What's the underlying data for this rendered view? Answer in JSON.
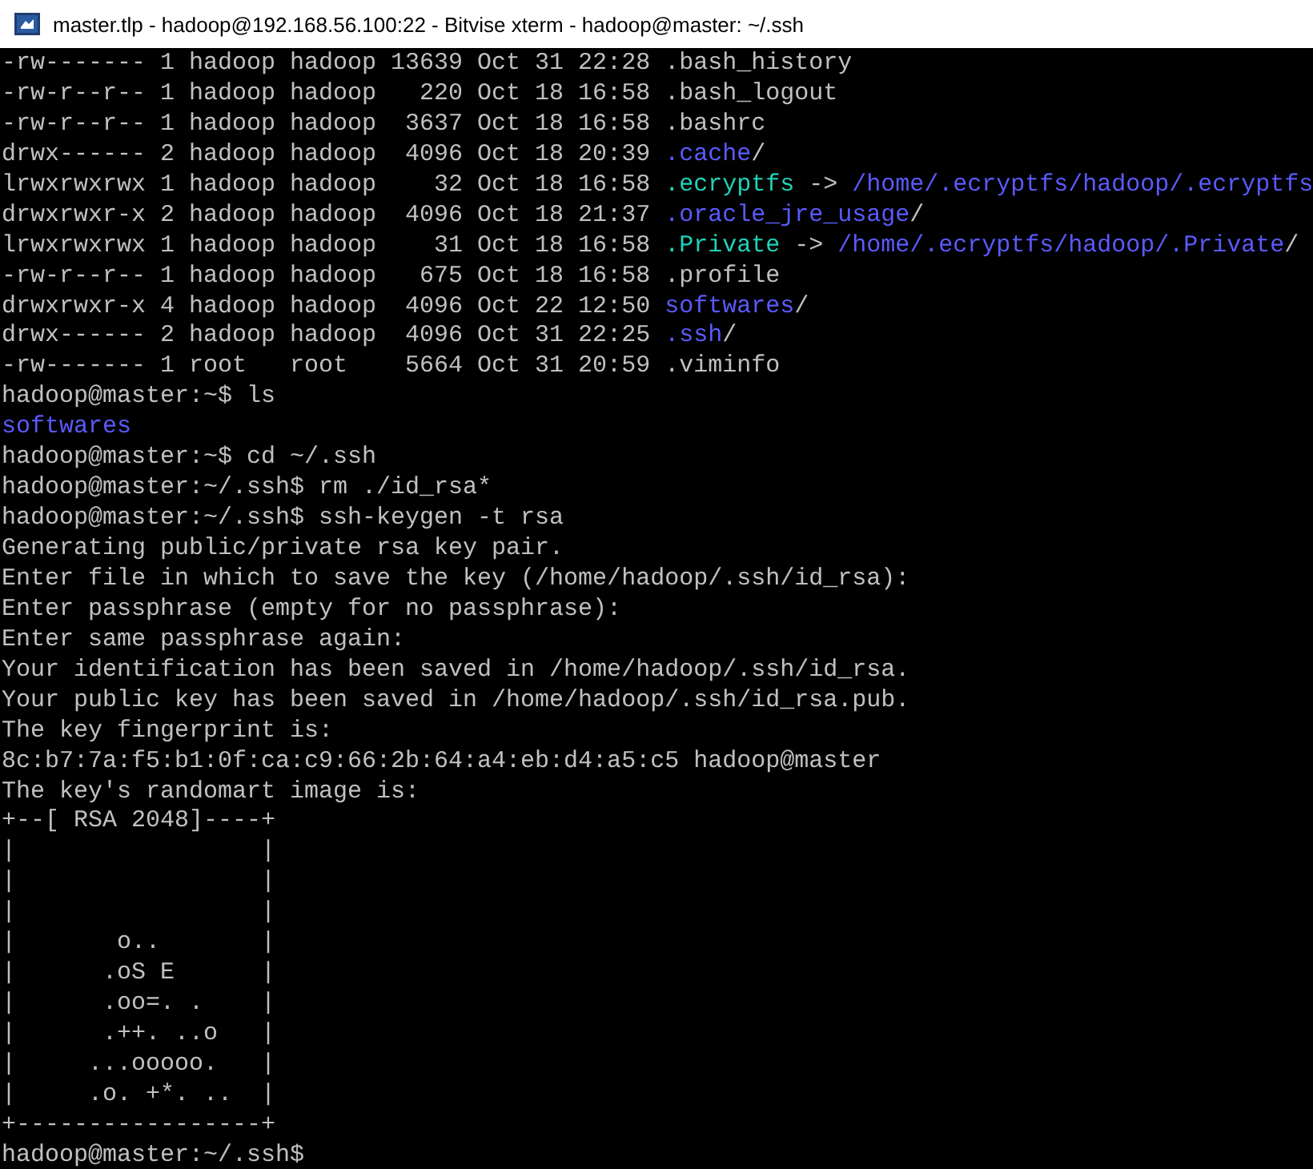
{
  "window": {
    "title": "master.tlp - hadoop@192.168.56.100:22 - Bitvise xterm - hadoop@master: ~/.ssh"
  },
  "terminal": {
    "lines": [
      {
        "segments": [
          {
            "kind": "plain",
            "text": "-rw------- 1 hadoop hadoop 13639 Oct 31 22:28 .bash_history"
          }
        ]
      },
      {
        "segments": [
          {
            "kind": "plain",
            "text": "-rw-r--r-- 1 hadoop hadoop   220 Oct 18 16:58 .bash_logout"
          }
        ]
      },
      {
        "segments": [
          {
            "kind": "plain",
            "text": "-rw-r--r-- 1 hadoop hadoop  3637 Oct 18 16:58 .bashrc"
          }
        ]
      },
      {
        "segments": [
          {
            "kind": "plain",
            "text": "drwx------ 2 hadoop hadoop  4096 Oct 18 20:39 "
          },
          {
            "kind": "dir",
            "text": ".cache"
          },
          {
            "kind": "plain",
            "text": "/"
          }
        ]
      },
      {
        "segments": [
          {
            "kind": "plain",
            "text": "lrwxrwxrwx 1 hadoop hadoop    32 Oct 18 16:58 "
          },
          {
            "kind": "link",
            "text": ".ecryptfs"
          },
          {
            "kind": "plain",
            "text": " -> "
          },
          {
            "kind": "dir",
            "text": "/home/.ecryptfs/hadoop/.ecryptfs"
          }
        ]
      },
      {
        "segments": [
          {
            "kind": "plain",
            "text": "drwxrwxr-x 2 hadoop hadoop  4096 Oct 18 21:37 "
          },
          {
            "kind": "dir",
            "text": ".oracle_jre_usage"
          },
          {
            "kind": "plain",
            "text": "/"
          }
        ]
      },
      {
        "segments": [
          {
            "kind": "plain",
            "text": "lrwxrwxrwx 1 hadoop hadoop    31 Oct 18 16:58 "
          },
          {
            "kind": "link",
            "text": ".Private"
          },
          {
            "kind": "plain",
            "text": " -> "
          },
          {
            "kind": "dir",
            "text": "/home/.ecryptfs/hadoop/.Private"
          },
          {
            "kind": "plain",
            "text": "/"
          }
        ]
      },
      {
        "segments": [
          {
            "kind": "plain",
            "text": "-rw-r--r-- 1 hadoop hadoop   675 Oct 18 16:58 .profile"
          }
        ]
      },
      {
        "segments": [
          {
            "kind": "plain",
            "text": "drwxrwxr-x 4 hadoop hadoop  4096 Oct 22 12:50 "
          },
          {
            "kind": "dir",
            "text": "softwares"
          },
          {
            "kind": "plain",
            "text": "/"
          }
        ]
      },
      {
        "segments": [
          {
            "kind": "plain",
            "text": "drwx------ 2 hadoop hadoop  4096 Oct 31 22:25 "
          },
          {
            "kind": "dir",
            "text": ".ssh"
          },
          {
            "kind": "plain",
            "text": "/"
          }
        ]
      },
      {
        "segments": [
          {
            "kind": "plain",
            "text": "-rw------- 1 root   root    5664 Oct 31 20:59 .viminfo"
          }
        ]
      },
      {
        "segments": [
          {
            "kind": "plain",
            "text": "hadoop@master:~$ ls"
          }
        ]
      },
      {
        "segments": [
          {
            "kind": "dir",
            "text": "softwares"
          }
        ]
      },
      {
        "segments": [
          {
            "kind": "plain",
            "text": "hadoop@master:~$ cd ~/.ssh"
          }
        ]
      },
      {
        "segments": [
          {
            "kind": "plain",
            "text": "hadoop@master:~/.ssh$ rm ./id_rsa*"
          }
        ]
      },
      {
        "segments": [
          {
            "kind": "plain",
            "text": "hadoop@master:~/.ssh$ ssh-keygen -t rsa"
          }
        ]
      },
      {
        "segments": [
          {
            "kind": "plain",
            "text": "Generating public/private rsa key pair."
          }
        ]
      },
      {
        "segments": [
          {
            "kind": "plain",
            "text": "Enter file in which to save the key (/home/hadoop/.ssh/id_rsa):"
          }
        ]
      },
      {
        "segments": [
          {
            "kind": "plain",
            "text": "Enter passphrase (empty for no passphrase):"
          }
        ]
      },
      {
        "segments": [
          {
            "kind": "plain",
            "text": "Enter same passphrase again:"
          }
        ]
      },
      {
        "segments": [
          {
            "kind": "plain",
            "text": "Your identification has been saved in /home/hadoop/.ssh/id_rsa."
          }
        ]
      },
      {
        "segments": [
          {
            "kind": "plain",
            "text": "Your public key has been saved in /home/hadoop/.ssh/id_rsa.pub."
          }
        ]
      },
      {
        "segments": [
          {
            "kind": "plain",
            "text": "The key fingerprint is:"
          }
        ]
      },
      {
        "segments": [
          {
            "kind": "plain",
            "text": "8c:b7:7a:f5:b1:0f:ca:c9:66:2b:64:a4:eb:d4:a5:c5 hadoop@master"
          }
        ]
      },
      {
        "segments": [
          {
            "kind": "plain",
            "text": "The key's randomart image is:"
          }
        ]
      },
      {
        "segments": [
          {
            "kind": "plain",
            "text": "+--[ RSA 2048]----+"
          }
        ]
      },
      {
        "segments": [
          {
            "kind": "plain",
            "text": "|                 |"
          }
        ]
      },
      {
        "segments": [
          {
            "kind": "plain",
            "text": "|                 |"
          }
        ]
      },
      {
        "segments": [
          {
            "kind": "plain",
            "text": "|                 |"
          }
        ]
      },
      {
        "segments": [
          {
            "kind": "plain",
            "text": "|       o..       |"
          }
        ]
      },
      {
        "segments": [
          {
            "kind": "plain",
            "text": "|      .oS E      |"
          }
        ]
      },
      {
        "segments": [
          {
            "kind": "plain",
            "text": "|      .oo=. .    |"
          }
        ]
      },
      {
        "segments": [
          {
            "kind": "plain",
            "text": "|      .++. ..o   |"
          }
        ]
      },
      {
        "segments": [
          {
            "kind": "plain",
            "text": "|     ...ooooo.   |"
          }
        ]
      },
      {
        "segments": [
          {
            "kind": "plain",
            "text": "|     .o. +*. ..  |"
          }
        ]
      },
      {
        "segments": [
          {
            "kind": "plain",
            "text": "+-----------------+"
          }
        ]
      },
      {
        "segments": [
          {
            "kind": "plain",
            "text": "hadoop@master:~/.ssh$"
          }
        ]
      }
    ]
  }
}
